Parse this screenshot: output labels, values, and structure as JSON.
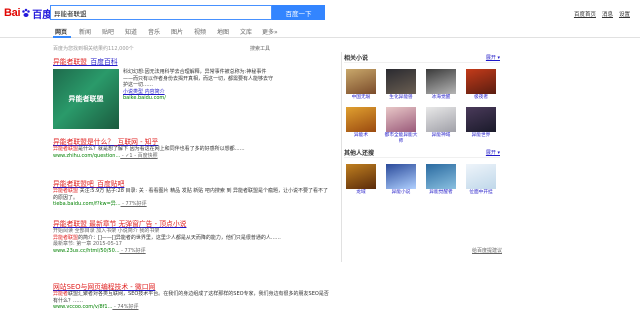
{
  "header": {
    "logo_left": "Bai",
    "logo_right": "百度",
    "query": "异能者联盟",
    "search_button": "百度一下",
    "top_links": [
      "百度首页",
      "消息",
      "设置"
    ]
  },
  "tabs": [
    "网页",
    "新闻",
    "贴吧",
    "知道",
    "音乐",
    "图片",
    "视频",
    "地图",
    "文库",
    "更多»"
  ],
  "result_count": "百度为您找到相关结果约112,000个",
  "search_tools": "搜索工具",
  "results": [
    {
      "title_pre": "异能者联盟",
      "title_em": "",
      "title_post": "_百度百科",
      "image_text": "异能者联盟",
      "abstract": "科幻幻想:因无法用科学去合理解释，异常事件被总称为:神秘事件——而只有以作者身份去揭开真相，而这一切，都需要有人能够去守护这一切……",
      "links": "小说类型    内容简介",
      "url": "baike.baidu.com/"
    },
    {
      "title_pre": "异能者联盟是什么？_互联网 - 知乎",
      "abstract_em": "异能者联盟",
      "abstract": "是什么？就是想了解下 因为看这在网上和同伴也看了多的好感所以想都……",
      "url": "www.zhihu.com/question...",
      "url_tail": " - ✓1 - 百度快照"
    },
    {
      "title_pre": "异能者联盟吧_百度贴吧",
      "abstract_em": "异能者联盟",
      "abstract": " 关注:5.9万 贴子:28 目录: 关 · 看看图片 精品 发贴 新贴 吧内搜索 到 异能者联盟是个瘋題，让小说不要了看不了的原因了。",
      "url": "tieba.baidu.com/f?kw=异...",
      "url_tail": " - 77%好评"
    },
    {
      "title_pre": "异能者联盟 最新章节 无弹窗广告 - 顶点小说",
      "meta": "开始阅读    全部目录    加入书架    小说简介    我的书架",
      "abstract_em": "异能者联盟",
      "abstract": "的简介：[]——[]异能者的世界里，这里少人都是从天而降的能力，他们只是很普通的人……",
      "date": "最新章节: 第一章 2015-05-17",
      "url": "www.23us.cc/html/50/50...",
      "url_tail": " - 77%好评"
    },
    {
      "title_pre": "网站SEO与网页编程技术 - 微口网",
      "abstract_em": "异能者",
      "abstract": "联盟汇聚者对各类互联网，SEO技术平台。在我们的身边组成了这样那样的SEO专家，我们身边有很多的朋友SEO是否有什么？……",
      "url": "www.vccoo.com/v/8f1...",
      "url_tail": " - 74%好评"
    }
  ],
  "right": {
    "panel1_title": "相关小说",
    "panel1_more": "展开 ▾",
    "books1": [
      "中国无垠",
      "生化异能兽",
      "冰海觉醒",
      "极夜者",
      "异能术",
      "都市全能异能大师",
      "异能神域",
      "异能世界"
    ],
    "panel2_title": "其他人还搜",
    "panel2_more": "展开 ▾",
    "books2": [
      "龙域",
      "异能小说",
      "异能觉醒者",
      "位面中开挂"
    ],
    "feedback": "给百度提建议"
  },
  "colors": {
    "link": "#2019c8",
    "highlight": "#e02121",
    "url_green": "#008000",
    "brand_blue": "#3385ff"
  }
}
